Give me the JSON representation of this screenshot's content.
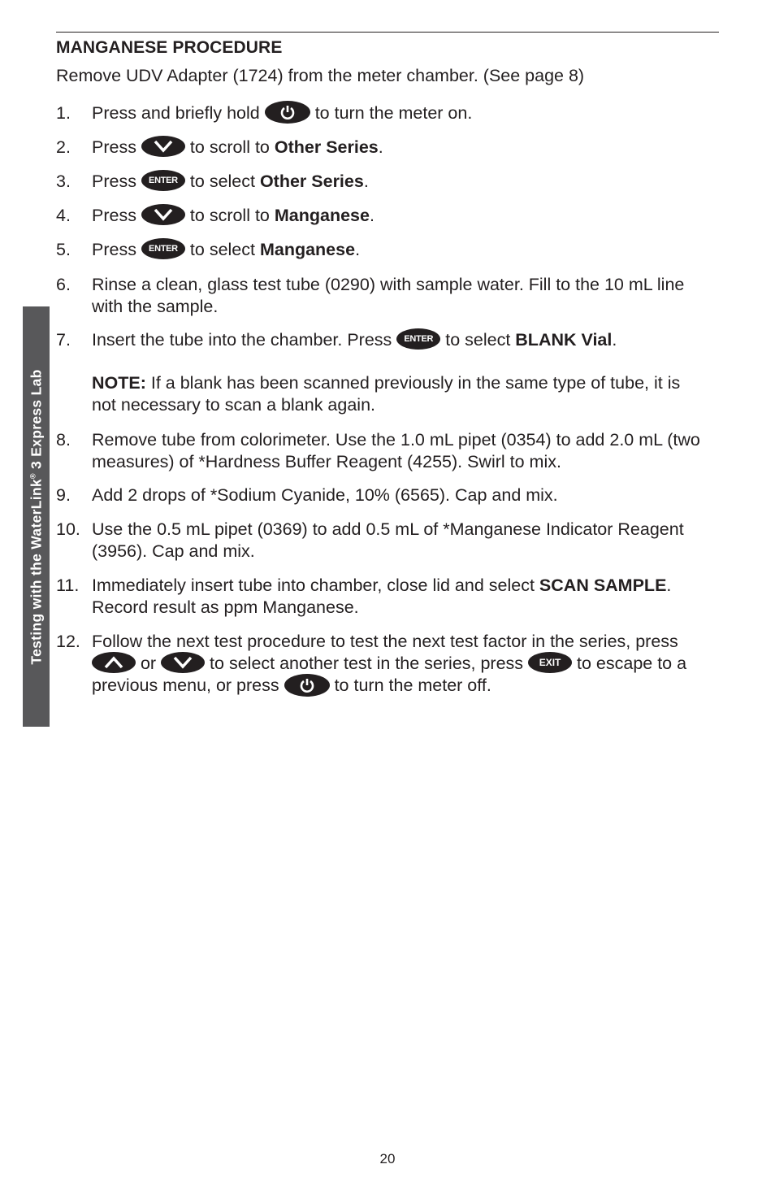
{
  "title": "MANGANESE PROCEDURE",
  "intro": "Remove UDV Adapter  (1724) from the meter chamber. (See page 8)",
  "side_tab": {
    "text_before": "Testing with the WaterLink",
    "registered": "®",
    "text_after": " 3 Express Lab"
  },
  "keys": {
    "enter": "ENTER",
    "exit": "EXIT",
    "power": "power-icon",
    "down": "chevron-down-icon",
    "up": "chevron-up-icon"
  },
  "steps": [
    {
      "num": "1.",
      "a": "Press and briefly hold ",
      "b": " to turn the meter on."
    },
    {
      "num": "2.",
      "a": "Press ",
      "b": " to scroll to ",
      "bold": "Other Series",
      "c": "."
    },
    {
      "num": "3.",
      "a": "Press ",
      "b": " to select ",
      "bold": "Other Series",
      "c": "."
    },
    {
      "num": "4.",
      "a": "Press ",
      "b": " to scroll to ",
      "bold": "Manganese",
      "c": "."
    },
    {
      "num": "5.",
      "a": "Press ",
      "b": " to select ",
      "bold": "Manganese",
      "c": "."
    },
    {
      "num": "6.",
      "text": "Rinse a clean, glass test tube (0290) with sample water. Fill to the 10 mL line with the sample."
    },
    {
      "num": "7.",
      "a": "Insert the tube into the chamber. Press ",
      "b": " to select ",
      "bold": "BLANK Vial",
      "c": ".",
      "note_label": "NOTE:",
      "note": " If a blank has been scanned previously in the same type of tube, it is not necessary to scan a blank again."
    },
    {
      "num": "8.",
      "text": "Remove tube from colorimeter. Use the 1.0 mL pipet (0354) to add 2.0 mL (two measures) of *Hardness Buffer Reagent (4255). Swirl to mix."
    },
    {
      "num": "9.",
      "text": "Add 2 drops of *Sodium Cyanide, 10% (6565). Cap and mix."
    },
    {
      "num": "10.",
      "text": "Use the 0.5 mL pipet (0369) to add 0.5 mL of *Manganese Indicator Reagent (3956). Cap and mix."
    },
    {
      "num": "11.",
      "a": "Immediately insert tube into chamber, close lid and select ",
      "bold": "SCAN SAMPLE",
      "c": ". Record result as ppm Manganese."
    },
    {
      "num": "12.",
      "a": "Follow the next test procedure to test the next test factor in the series, press ",
      "or": " or ",
      "b": " to select another test in the series, press ",
      "c": " to escape to a previous menu, or press ",
      "d": " to turn the meter off."
    }
  ],
  "page_number": "20"
}
